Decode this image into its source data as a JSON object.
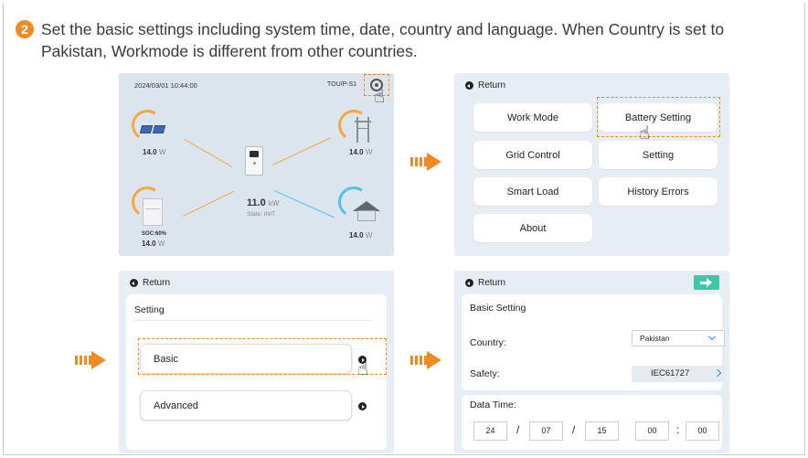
{
  "step": {
    "number": "2",
    "text": "Set the basic settings including system time, date, country and language. When Country is set to Pakistan, Workmode is different from other countries."
  },
  "home_screen": {
    "datetime": "2024/03/01 10:44:00",
    "mode": "TOU/P-S1",
    "pv_value": "14.0",
    "pv_unit": "W",
    "grid_value": "14.0",
    "grid_unit": "W",
    "inverter_value": "11.0",
    "inverter_unit": "kW",
    "state": "State: INIT",
    "battery_soc": "SOC:60%",
    "battery_value": "14.0",
    "battery_unit": "W",
    "load_value": "14.0",
    "load_unit": "W"
  },
  "menu_screen": {
    "return_label": "Return",
    "buttons": [
      "Work Mode",
      "Battery Setting",
      "Grid Control",
      "Setting",
      "Smart Load",
      "History Errors",
      "About"
    ]
  },
  "setting_screen": {
    "return_label": "Return",
    "title": "Setting",
    "items": [
      "Basic",
      "Advanced"
    ]
  },
  "basic_screen": {
    "return_label": "Return",
    "title": "Basic Setting",
    "country_label": "Country:",
    "country_value": "Pakistan",
    "safety_label": "Safety:",
    "safety_value": "IEC61727",
    "datetime_label": "Data Time:",
    "date": [
      "24",
      "07",
      "15"
    ],
    "time": [
      "00",
      "00"
    ]
  },
  "colors": {
    "accent_orange": "#f08a25",
    "next_green": "#3cc8a6",
    "screen_bg": "#e7edf4",
    "flow_blue": "#4cc4e6"
  }
}
